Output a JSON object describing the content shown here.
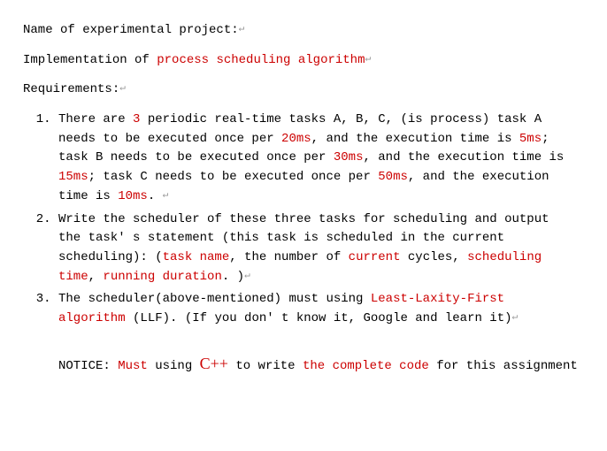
{
  "title_label": "Name of experimental project:",
  "subtitle_prefix": "Implementation of ",
  "subtitle_highlight": "process scheduling algorithm",
  "requirements_label": "Requirements:",
  "para_mark": "↵",
  "item1": {
    "p1": "There are ",
    "p2": "3",
    "p3": " periodic real-time tasks A, B, C, (is process) task A needs to be executed once per ",
    "p4": "20ms",
    "p5": ", and the execution time is ",
    "p6": "5ms",
    "p7": "; task B needs to be executed once per ",
    "p8": "30ms",
    "p9": ", and the execution time is ",
    "p10": "15ms",
    "p11": "; task C needs to be executed once per ",
    "p12": "50ms",
    "p13": ", and the execution time is ",
    "p14": "10ms",
    "p15": ". "
  },
  "item2": {
    "p1": "Write the scheduler of these three tasks for scheduling and output the task' s statement (this task is scheduled in the current scheduling): (",
    "p2": "task name",
    "p3": ", the number of ",
    "p4": "current",
    "p5": " cycles, ",
    "p6": "scheduling time",
    "p7": ", ",
    "p8": "running duration",
    "p9": ". )"
  },
  "item3": {
    "p1": "The scheduler(above-mentioned) must using ",
    "p2": "Least-Laxity-First algorithm",
    "p3": " (LLF). (If you don' t know it, Google and learn it)"
  },
  "notice": {
    "p1": "NOTICE: ",
    "p2": "Must",
    "p3": " using ",
    "p4": "C++",
    "p5": " to write ",
    "p6": "the complete code",
    "p7": " for this assignment"
  }
}
